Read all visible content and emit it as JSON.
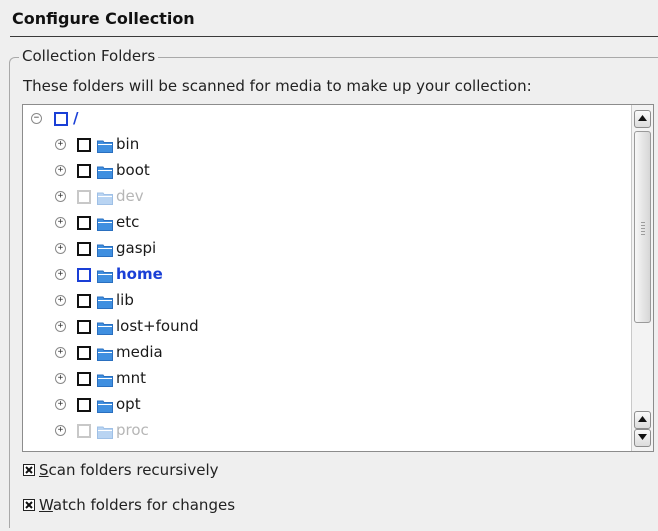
{
  "header": {
    "title": "Configure Collection"
  },
  "group": {
    "title": "Collection Folders",
    "description": "These folders will be scanned for media to make up your collection:"
  },
  "tree": {
    "root": {
      "label": "/",
      "expanded": true,
      "checked": false
    },
    "items": [
      {
        "label": "bin",
        "state": "normal"
      },
      {
        "label": "boot",
        "state": "normal"
      },
      {
        "label": "dev",
        "state": "disabled"
      },
      {
        "label": "etc",
        "state": "normal"
      },
      {
        "label": "gaspi",
        "state": "normal",
        "icon": "user-folder-icon"
      },
      {
        "label": "home",
        "state": "highlighted"
      },
      {
        "label": "lib",
        "state": "normal"
      },
      {
        "label": "lost+found",
        "state": "normal"
      },
      {
        "label": "media",
        "state": "normal"
      },
      {
        "label": "mnt",
        "state": "normal"
      },
      {
        "label": "opt",
        "state": "normal"
      },
      {
        "label": "proc",
        "state": "disabled"
      }
    ]
  },
  "options": {
    "scan_recursive": {
      "mnemonic": "S",
      "rest": "can folders recursively",
      "checked": true
    },
    "watch_changes": {
      "mnemonic": "W",
      "rest": "atch folders for changes",
      "checked": true
    }
  },
  "colors": {
    "accent": "#1a3fd6",
    "folder": "#3f8fe0",
    "disabled_text": "#b6b6b6",
    "background": "#efefef"
  }
}
